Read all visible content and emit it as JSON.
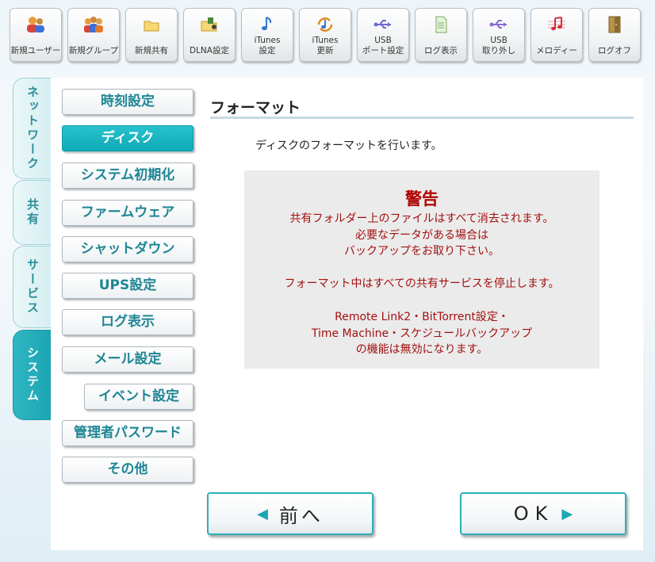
{
  "toolbar": {
    "buttons": [
      {
        "label": "新規ユーザー"
      },
      {
        "label": "新規グループ"
      },
      {
        "label": "新規共有"
      },
      {
        "label": "DLNA設定"
      },
      {
        "label": "iTunes\n設定"
      },
      {
        "label": "iTunes\n更新"
      },
      {
        "label": "USB\nポート設定"
      },
      {
        "label": "ログ表示"
      },
      {
        "label": "USB\n取り外し"
      },
      {
        "label": "メロディー"
      },
      {
        "label": "ログオフ"
      }
    ]
  },
  "tabs": [
    {
      "label": "ネットワーク"
    },
    {
      "label": "共有"
    },
    {
      "label": "サービス"
    },
    {
      "label": "システム"
    }
  ],
  "menu": [
    {
      "label": "時刻設定"
    },
    {
      "label": "ディスク"
    },
    {
      "label": "システム初期化"
    },
    {
      "label": "ファームウェア"
    },
    {
      "label": "シャットダウン"
    },
    {
      "label": "UPS設定"
    },
    {
      "label": "ログ表示"
    },
    {
      "label": "メール設定"
    },
    {
      "label": "イベント設定"
    },
    {
      "label": "管理者パスワード"
    },
    {
      "label": "その他"
    }
  ],
  "content": {
    "title": "フォーマット",
    "description": "ディスクのフォーマットを行います。",
    "warning": {
      "title": "警告",
      "lines": [
        "共有フォルダー上のファイルはすべて消去されます。",
        "必要なデータがある場合は",
        "バックアップをお取り下さい。",
        "フォーマット中はすべての共有サービスを停止します。",
        "Remote Link2・BitTorrent設定・",
        "Time Machine・スケジュールバックアップ",
        "の機能は無効になります。"
      ]
    }
  },
  "nav": {
    "prev_label": "前へ",
    "ok_label": "OK"
  },
  "colors": {
    "accent": "#1aa7b4",
    "warning_text": "#a31010"
  }
}
